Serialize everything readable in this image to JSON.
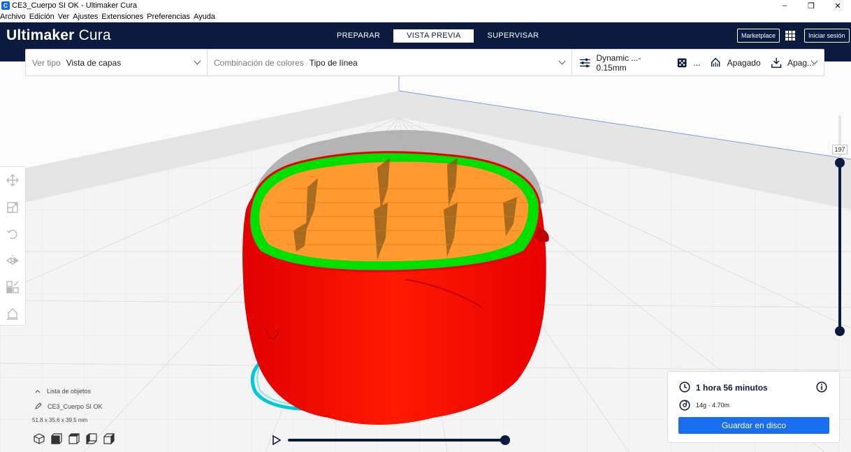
{
  "window": {
    "title": "CE3_Cuerpo SI OK - Ultimaker Cura",
    "app_icon": "C",
    "buttons": {
      "minimize": "–",
      "restore": "❐",
      "close": "✕"
    }
  },
  "menu": {
    "items": [
      {
        "label": "Archivo"
      },
      {
        "label": "Edición"
      },
      {
        "label": "Ver"
      },
      {
        "label": "Ajustes"
      },
      {
        "label": "Extensiones"
      },
      {
        "label": "Preferencias"
      },
      {
        "label": "Ayuda"
      }
    ]
  },
  "header": {
    "logo_bold": "Ultimaker",
    "logo_light": "Cura",
    "tabs": [
      {
        "label": "PREPARAR",
        "active": false
      },
      {
        "label": "VISTA PREVIA",
        "active": true
      },
      {
        "label": "SUPERVISAR",
        "active": false
      }
    ],
    "marketplace": "Marketplace",
    "signin": "Iniciar sesión"
  },
  "viewbar": {
    "view_type_label": "Ver tipo",
    "view_type_value": "Vista de capas",
    "color_scheme_label": "Combinación de colores",
    "color_scheme_value": "Tipo de línea",
    "profile": "Dynamic ...- 0.15mm",
    "infill_value": "...",
    "support": "Apagado",
    "adhesion": "Apag..."
  },
  "layer_slider": {
    "current_layer": "197"
  },
  "object_list": {
    "toggle_label": "Lista de objetos",
    "object_name": "CE3_Cuerpo SI OK",
    "dimensions": "51.8 x 35.6 x 39.5 mm"
  },
  "print_info": {
    "time": "1 hora 56 minutos",
    "material": "14g · 4.70m",
    "save_button": "Guardar en disco"
  },
  "colors": {
    "header_bg": "#0b1a3f",
    "accent_blue": "#196ef0",
    "model_wall": "#ff0000",
    "model_infill": "#ffa034",
    "model_inner_wall": "#00ff00",
    "skirt": "#00d4dc"
  }
}
